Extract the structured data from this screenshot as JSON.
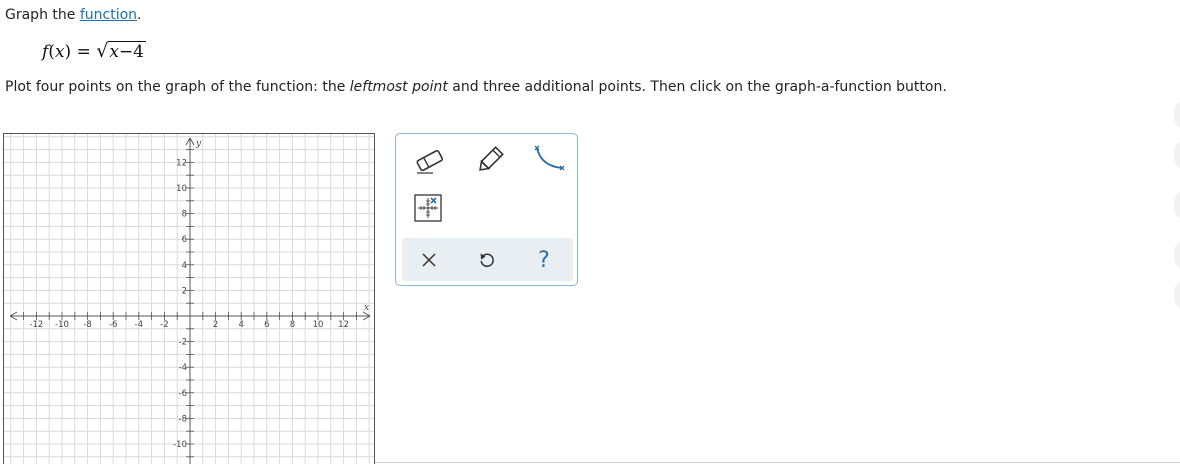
{
  "prompt": {
    "prefix": "Graph the ",
    "link_label": "function",
    "suffix": "."
  },
  "formula": {
    "fname": "f",
    "arg": "x",
    "equals": "=",
    "radical_sign": "√",
    "radicand_var": "x",
    "radicand_rest": "−4"
  },
  "instructions": {
    "part1": "Plot four points on the graph of the function: the ",
    "emphasis": "leftmost point",
    "part2": " and three additional points. Then click on the graph-a-function button."
  },
  "graph": {
    "x_axis_label": "x",
    "y_axis_label": "y",
    "x_ticks": [
      -12,
      -10,
      -8,
      -6,
      -4,
      -2,
      2,
      4,
      6,
      8,
      10,
      12
    ],
    "y_ticks": [
      12,
      10,
      8,
      6,
      4,
      2,
      -2,
      -4,
      -6,
      -8,
      -10
    ],
    "x_range": [
      -14,
      14
    ],
    "y_range": [
      -12,
      14
    ],
    "grid": true,
    "grid_step": 1,
    "grid_color": "#d9d9d9",
    "axis_color": "#555555"
  },
  "toolbox": {
    "tools": [
      "eraser-icon",
      "pencil-icon",
      "graph-function-icon",
      "point-grid-icon"
    ],
    "actions": [
      "clear-icon",
      "undo-icon",
      "help-icon"
    ],
    "help_label": "?",
    "border_color": "#8fb4d0",
    "accent_color": "#2a6ea8"
  }
}
